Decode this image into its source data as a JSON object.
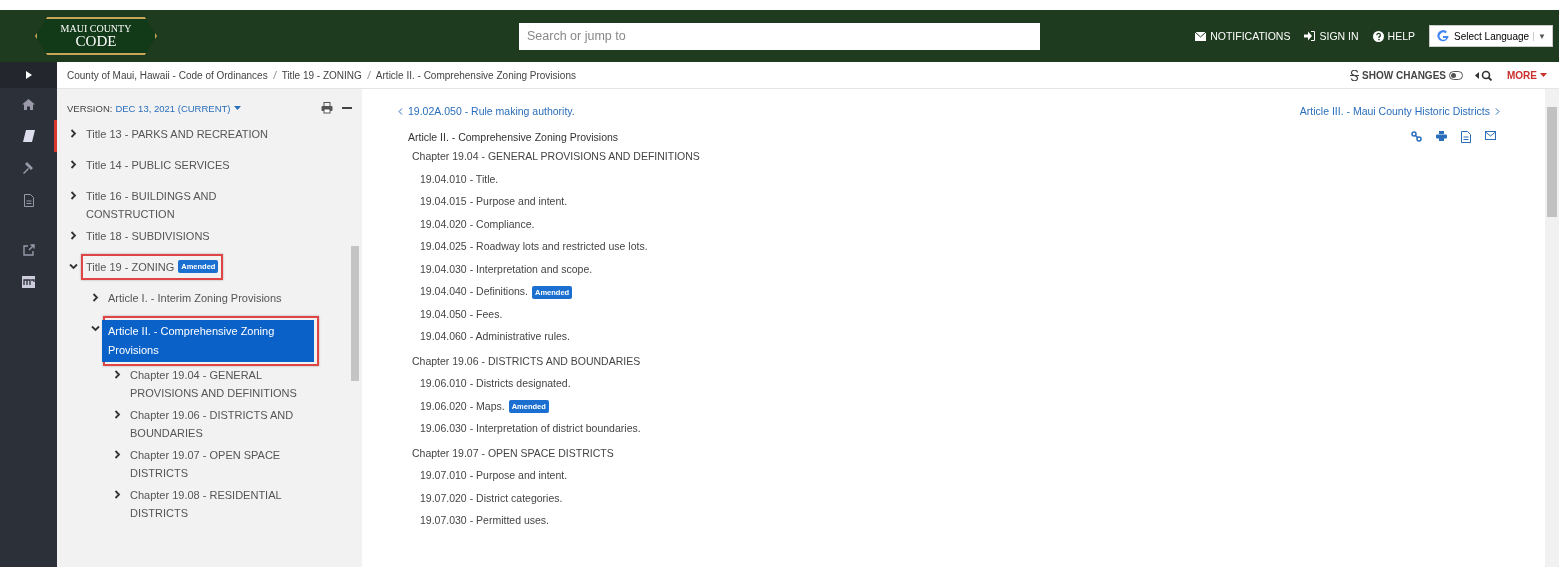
{
  "header": {
    "logo": {
      "line_1": "MAUI COUNTY",
      "line_2": "CODE"
    },
    "search": {
      "placeholder": "Search or jump to"
    },
    "links": [
      {
        "kind": "mail",
        "label": "NOTIFICATIONS"
      },
      {
        "kind": "signin",
        "label": "SIGN IN"
      },
      {
        "kind": "help",
        "label": "HELP"
      }
    ],
    "language": {
      "label": "Select Language",
      "caret": "▼"
    }
  },
  "rail": [
    {
      "kind": "home",
      "selected": false
    },
    {
      "kind": "book",
      "selected": true
    },
    {
      "kind": "gavel",
      "selected": false
    },
    {
      "kind": "document",
      "selected": false
    },
    {
      "kind": "external",
      "selected": false
    },
    {
      "kind": "logo",
      "selected": false
    }
  ],
  "breadcrumb": [
    "County of Maui, Hawaii - Code of Ordinances",
    "Title 19 - ZONING",
    "Article II. - Comprehensive Zoning Provisions"
  ],
  "toolbar": {
    "show_changes": "SHOW CHANGES",
    "more": "MORE"
  },
  "version": {
    "label": "VERSION:",
    "value": "DEC 13, 2021 (CURRENT)"
  },
  "tree": [
    {
      "label": "Title 13 - PARKS AND RECREATION",
      "expanded": false,
      "selected": false,
      "highlighted": false
    },
    {
      "label": "Title 14 - PUBLIC SERVICES",
      "expanded": false,
      "selected": false,
      "highlighted": false
    },
    {
      "label": "Title 16 - BUILDINGS AND CONSTRUCTION",
      "expanded": false,
      "selected": false,
      "highlighted": false
    },
    {
      "label": "Title 18 - SUBDIVISIONS",
      "expanded": false,
      "selected": false,
      "highlighted": false
    },
    {
      "label": "Title 19 - ZONING",
      "badge": "Amended",
      "expanded": true,
      "selected": false,
      "highlighted": true,
      "children": [
        {
          "label": "Article I. - Interim Zoning Provisions",
          "expanded": false,
          "selected": false,
          "highlighted": false
        },
        {
          "label": "Article II. - Comprehensive Zoning Provisions",
          "expanded": true,
          "selected": true,
          "highlighted": true,
          "children": [
            {
              "label": "Chapter 19.04 - GENERAL PROVISIONS AND DEFINITIONS",
              "expanded": false,
              "selected": false,
              "highlighted": false
            },
            {
              "label": "Chapter 19.06 - DISTRICTS AND BOUNDARIES",
              "expanded": false,
              "selected": false,
              "highlighted": false
            },
            {
              "label": "Chapter 19.07 - OPEN SPACE DISTRICTS",
              "expanded": false,
              "selected": false,
              "highlighted": false
            },
            {
              "label": "Chapter 19.08 - RESIDENTIAL DISTRICTS",
              "expanded": false,
              "selected": false,
              "highlighted": false
            }
          ]
        }
      ]
    }
  ],
  "content": {
    "prev": "19.02A.050 - Rule making authority.",
    "next": "Article III. - Maui County Historic Districts",
    "heading": "Article II. - Comprehensive Zoning Provisions",
    "chapters": [
      {
        "title": "Chapter 19.04 - GENERAL PROVISIONS AND DEFINITIONS",
        "sections": [
          {
            "label": "19.04.010 - Title."
          },
          {
            "label": "19.04.015 - Purpose and intent."
          },
          {
            "label": "19.04.020 - Compliance."
          },
          {
            "label": "19.04.025 - Roadway lots and restricted use lots."
          },
          {
            "label": "19.04.030 - Interpretation and scope."
          },
          {
            "label": "19.04.040 - Definitions.",
            "badge": "Amended"
          },
          {
            "label": "19.04.050 - Fees."
          },
          {
            "label": "19.04.060 - Administrative rules."
          }
        ]
      },
      {
        "title": "Chapter 19.06 - DISTRICTS AND BOUNDARIES",
        "sections": [
          {
            "label": "19.06.010 - Districts designated."
          },
          {
            "label": "19.06.020 - Maps.",
            "badge": "Amended"
          },
          {
            "label": "19.06.030 - Interpretation of district boundaries."
          }
        ]
      },
      {
        "title": "Chapter 19.07 - OPEN SPACE DISTRICTS",
        "sections": [
          {
            "label": "19.07.010 - Purpose and intent."
          },
          {
            "label": "19.07.020 - District categories."
          },
          {
            "label": "19.07.030 - Permitted uses."
          }
        ]
      }
    ]
  }
}
